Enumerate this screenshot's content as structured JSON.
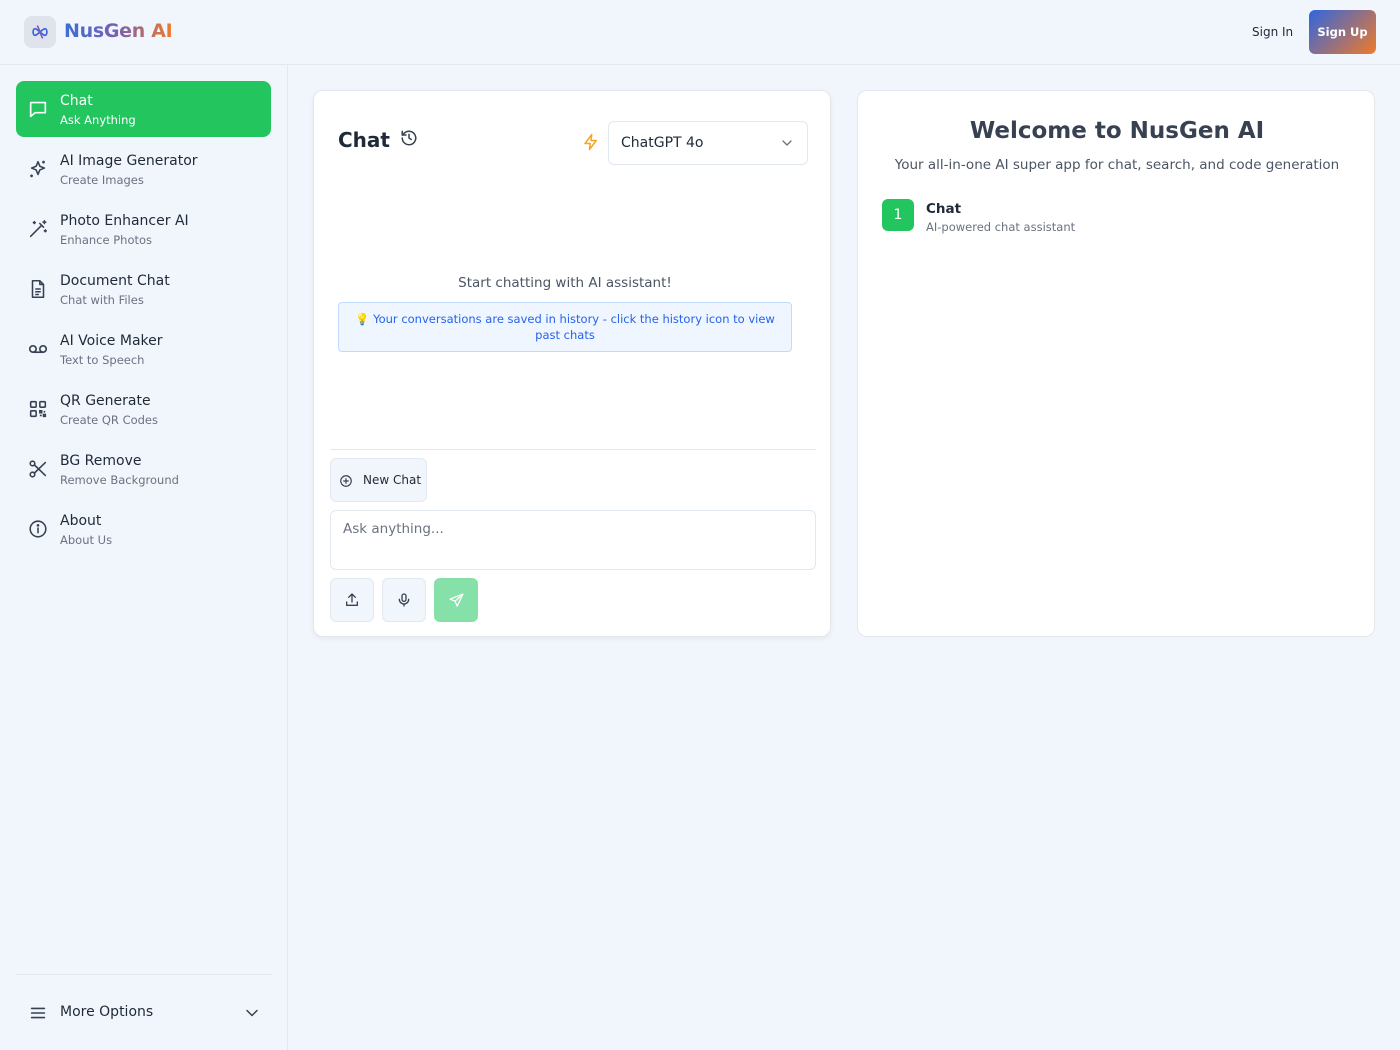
{
  "header": {
    "app_name": "NusGen AI",
    "logo_icon": "infinity-logo-icon",
    "sign_in_label": "Sign In",
    "sign_up_label": "Sign Up"
  },
  "sidebar": {
    "items": [
      {
        "label": "Chat",
        "sub": "Ask Anything",
        "icon": "chat-bubble-icon",
        "active": true
      },
      {
        "label": "AI Image Generator",
        "sub": "Create Images",
        "icon": "sparkles-icon"
      },
      {
        "label": "Photo Enhancer AI",
        "sub": "Enhance Photos",
        "icon": "magic-wand-icon"
      },
      {
        "label": "Document Chat",
        "sub": "Chat with Files",
        "icon": "document-icon"
      },
      {
        "label": "AI Voice Maker",
        "sub": "Text to Speech",
        "icon": "voicemail-icon"
      },
      {
        "label": "QR Generate",
        "sub": "Create QR Codes",
        "icon": "qr-code-icon"
      },
      {
        "label": "BG Remove",
        "sub": "Remove Background",
        "icon": "scissors-icon"
      },
      {
        "label": "About",
        "sub": "About Us",
        "icon": "info-icon"
      }
    ],
    "more_options_label": "More Options"
  },
  "chat": {
    "title": "Chat",
    "model_selected": "ChatGPT 4o",
    "empty_text": "Start chatting with AI assistant!",
    "history_notice": "💡 Your conversations are saved in history - click the history icon to view past chats",
    "new_chat_label": "New Chat",
    "input_placeholder": "Ask anything...",
    "input_value": ""
  },
  "welcome": {
    "title": "Welcome to NusGen AI",
    "subtitle": "Your all-in-one AI super app for chat, search, and code generation",
    "features": [
      {
        "number": "1",
        "name": "Chat",
        "description": "AI-powered chat assistant"
      }
    ]
  },
  "colors": {
    "accent_green": "#22c55e",
    "background": "#f1f6fd",
    "brand_gradient_start": "#2f66e0",
    "brand_gradient_end": "#f07a2a",
    "bolt": "#f5a524"
  }
}
